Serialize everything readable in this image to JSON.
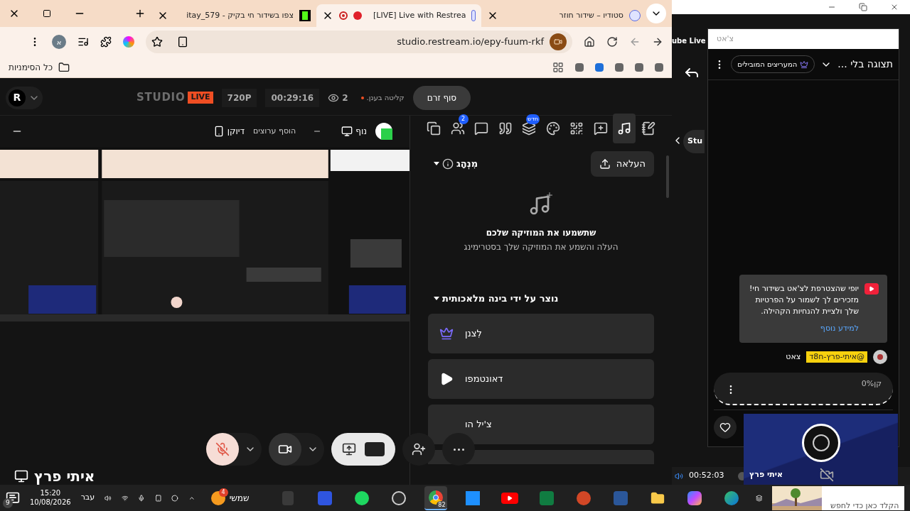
{
  "browser": {
    "tabs": [
      {
        "title": "סטודיו – שידור חוזר",
        "selected": false,
        "recording": false
      },
      {
        "title": "[LIVE] Live with Restrea",
        "selected": true,
        "recording": true
      },
      {
        "title": "itay_579 - צפו בשידור חי בקיק",
        "selected": false,
        "recording": false
      }
    ],
    "url": "studio.restream.io/epy-fuum-rkf",
    "profile_initial": "א",
    "bookmarks_label": "כל הסימניות"
  },
  "studio": {
    "logo": "R",
    "brand": "STUDIO",
    "live_badge": "LIVE",
    "resolution": "720P",
    "elapsed": "00:29:16",
    "viewers": "2",
    "cloud_status": "קליטה בענן.",
    "end_button": "סוף זרם",
    "layouts": [
      {
        "label": "נוף",
        "kind": "landscape"
      },
      {
        "label": "דיוקן",
        "kind": "portrait"
      }
    ],
    "add_channels": "הוסף ערוצים",
    "controls": {
      "mic_muted": true,
      "screen_share": true
    },
    "presenter": "איתי פרץ",
    "panel": {
      "tabs": [
        {
          "kind": "notes",
          "selected": false
        },
        {
          "kind": "music",
          "selected": true
        },
        {
          "kind": "sticker",
          "selected": false
        },
        {
          "kind": "qr",
          "selected": false
        },
        {
          "kind": "palette",
          "selected": false
        },
        {
          "kind": "layers",
          "selected": false,
          "badge": "חדש"
        },
        {
          "kind": "quote",
          "selected": false
        },
        {
          "kind": "chat",
          "selected": false
        },
        {
          "kind": "people",
          "selected": false,
          "badge": "2"
        },
        {
          "kind": "copy",
          "selected": false
        }
      ],
      "custom_section": {
        "title": "מִנְהָג",
        "expanded": true
      },
      "upload_button": "העלאה",
      "empty_title": "שתשמעו את המוזיקה שלכם",
      "empty_subtitle": "העלה והשמע את המוזיקה שלך בסטרימינג",
      "ai_section": {
        "title": "נוצר על ידי בינה מלאכותית",
        "expanded": true
      },
      "tracks": [
        {
          "title": "לִצנן",
          "kind": "premium"
        },
        {
          "title": "דאונטמפו",
          "kind": "play"
        },
        {
          "title": "צ'יל הו",
          "kind": "covered"
        }
      ]
    }
  },
  "background_window": {
    "tab_fragment": "ube Live",
    "pill_fragment": "Stu",
    "timer": "00:52:03"
  },
  "chat": {
    "title": "צ'אט",
    "view": "תצוגה בלי ...",
    "top_fans": "המעריצים המובילים",
    "notice": "יופי שהצטרפת לצ'אט בשידור חי! מזכירים לך לשמור על הפרטיות שלך ולציית להנחיות הקהילה.",
    "notice_link": "למידע נוסף",
    "message": {
      "mention": "@איתי-פרץ-ח8ד",
      "text": "צאט"
    },
    "input": {
      "value": "קן",
      "progress": "0%"
    }
  },
  "camera_preview": {
    "name": "איתי פרץ"
  },
  "taskbar": {
    "notifications": "9",
    "time": "15:20",
    "date": "10/08/2026",
    "language": "עבר",
    "weather": "שמשי",
    "weather_badge": "4",
    "chrome_badge": "82",
    "search": "הקלד כאן כדי לחפש",
    "apps": [
      {
        "kind": "blank",
        "selected": false
      },
      {
        "kind": "store",
        "selected": false
      },
      {
        "kind": "spotify",
        "selected": false
      },
      {
        "kind": "obs",
        "selected": false
      },
      {
        "kind": "chrome",
        "selected": true
      },
      {
        "kind": "windows",
        "selected": false
      },
      {
        "kind": "youtube",
        "selected": false
      },
      {
        "kind": "excel",
        "selected": false
      },
      {
        "kind": "powerpoint",
        "selected": false
      },
      {
        "kind": "word",
        "selected": false
      },
      {
        "kind": "folder",
        "selected": false
      },
      {
        "kind": "copilot",
        "selected": false
      },
      {
        "kind": "edge",
        "selected": false
      }
    ]
  }
}
